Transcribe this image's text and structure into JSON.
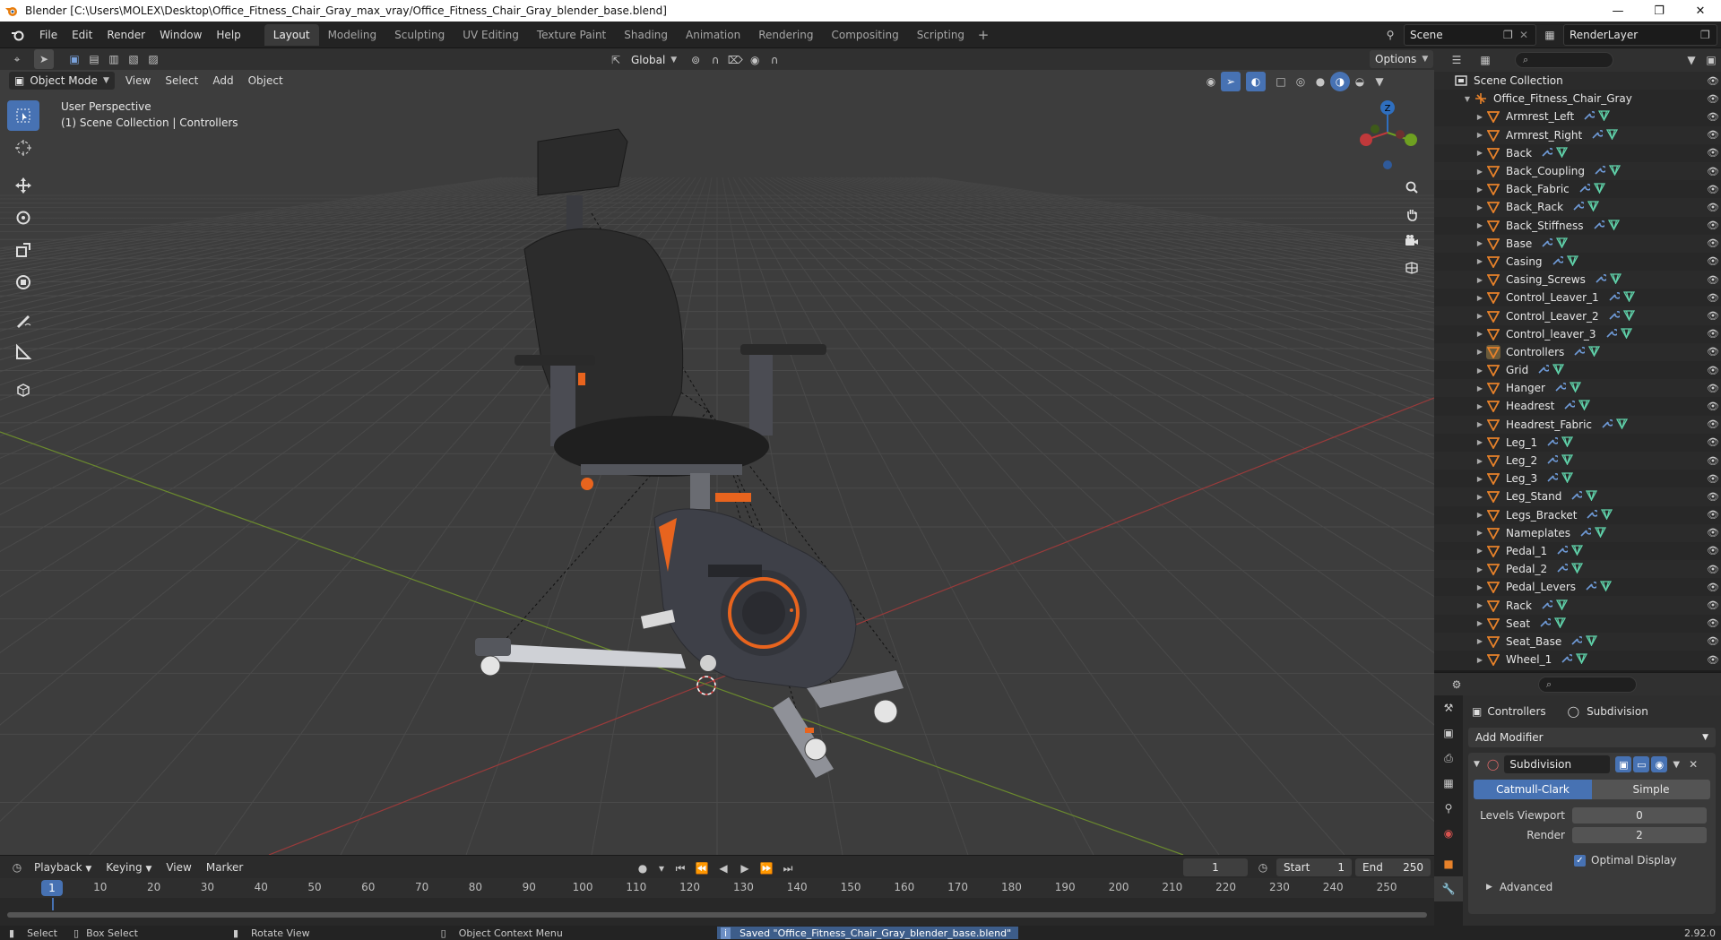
{
  "window": {
    "title": "Blender [C:\\Users\\MOLEX\\Desktop\\Office_Fitness_Chair_Gray_max_vray/Office_Fitness_Chair_Gray_blender_base.blend]"
  },
  "menu": [
    "File",
    "Edit",
    "Render",
    "Window",
    "Help"
  ],
  "workspaces": [
    "Layout",
    "Modeling",
    "Sculpting",
    "UV Editing",
    "Texture Paint",
    "Shading",
    "Animation",
    "Rendering",
    "Compositing",
    "Scripting"
  ],
  "active_workspace": "Layout",
  "scene": {
    "name": "Scene",
    "view_layer": "RenderLayer"
  },
  "viewport_header": {
    "transform_orientation": "Global",
    "options_label": "Options",
    "mode": "Object Mode",
    "menus": [
      "View",
      "Select",
      "Add",
      "Object"
    ]
  },
  "viewport": {
    "perspective": "User Perspective",
    "collection_info": "(1) Scene Collection | Controllers",
    "gizmo_axes": {
      "x": "X",
      "y": "Y",
      "z": "Z"
    }
  },
  "outliner": {
    "root": "Scene Collection",
    "collection": "Office_Fitness_Chair_Gray",
    "objects": [
      "Armrest_Left",
      "Armrest_Right",
      "Back",
      "Back_Coupling",
      "Back_Fabric",
      "Back_Rack",
      "Back_Stiffness",
      "Base",
      "Casing",
      "Casing_Screws",
      "Control_Leaver_1",
      "Control_Leaver_2",
      "Control_leaver_3",
      "Controllers",
      "Grid",
      "Hanger",
      "Headrest",
      "Headrest_Fabric",
      "Leg_1",
      "Leg_2",
      "Leg_3",
      "Leg_Stand",
      "Legs_Bracket",
      "Nameplates",
      "Pedal_1",
      "Pedal_2",
      "Pedal_Levers",
      "Rack",
      "Seat",
      "Seat_Base",
      "Wheel_1"
    ],
    "active_object": "Controllers"
  },
  "properties": {
    "object": "Controllers",
    "modifier_tab": "Subdivision",
    "add_modifier": "Add Modifier",
    "modifier_name": "Subdivision",
    "algo_options": [
      "Catmull-Clark",
      "Simple"
    ],
    "algo_selected": "Catmull-Clark",
    "levels_viewport_label": "Levels Viewport",
    "levels_viewport": "0",
    "render_label": "Render",
    "render_levels": "2",
    "optimal_display": "Optimal Display",
    "advanced": "Advanced"
  },
  "timeline": {
    "menus": [
      "Playback",
      "Keying",
      "View",
      "Marker"
    ],
    "current_frame": "1",
    "start_label": "Start",
    "start": "1",
    "end_label": "End",
    "end": "250",
    "ticks": [
      "10",
      "20",
      "30",
      "40",
      "50",
      "60",
      "70",
      "80",
      "90",
      "100",
      "110",
      "120",
      "130",
      "140",
      "150",
      "160",
      "170",
      "180",
      "190",
      "200",
      "210",
      "220",
      "230",
      "240",
      "250"
    ],
    "cursor_label": "1"
  },
  "statusbar": {
    "select": "Select",
    "box_select": "Box Select",
    "rotate_view": "Rotate View",
    "context_menu": "Object Context Menu",
    "message": "Saved \"Office_Fitness_Chair_Gray_blender_base.blend\"",
    "version": "2.92.0"
  },
  "colors": {
    "accent": "#4772b3",
    "object_icon": "#e8822a",
    "modifier_icon": "#6f9bd8",
    "mesh_icon": "#5fd1a9",
    "x_axis": "#9a3b3b",
    "y_axis": "#6b8a2e",
    "orange_trim": "#e8641e"
  }
}
